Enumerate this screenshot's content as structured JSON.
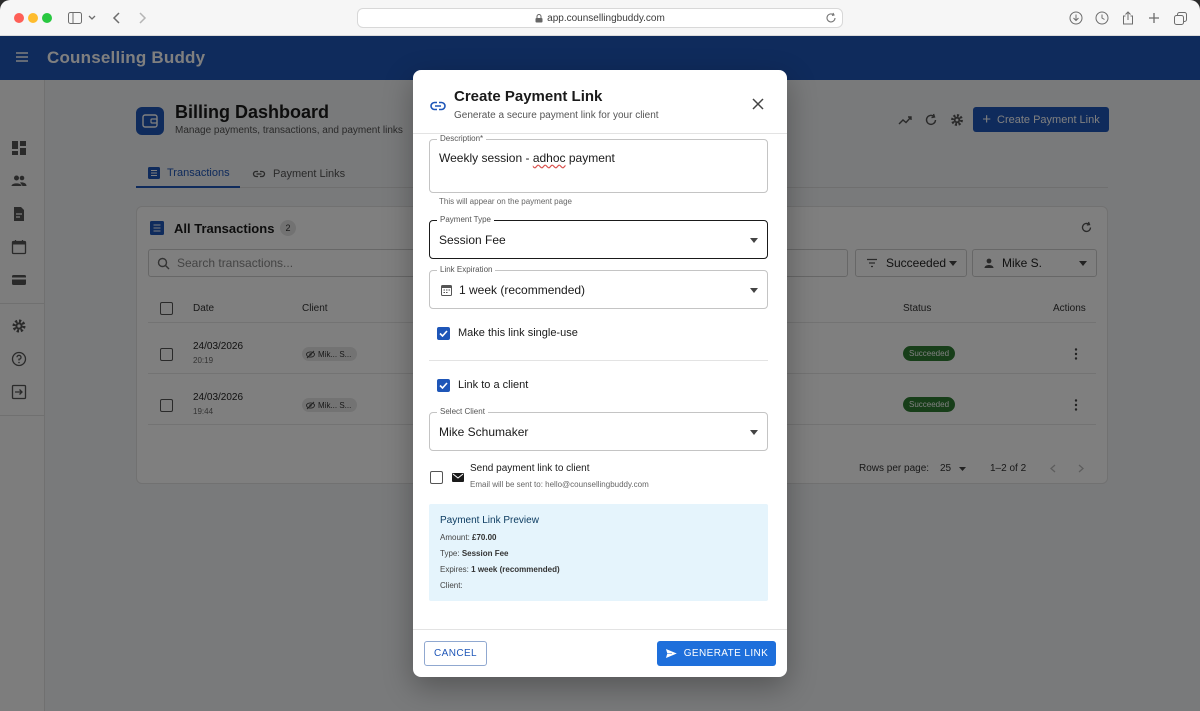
{
  "browser": {
    "url": "app.counsellingbuddy.com"
  },
  "app": {
    "brand": "Counselling Buddy"
  },
  "page": {
    "title": "Billing Dashboard",
    "subtitle": "Manage payments, transactions, and payment links",
    "create_button": "Create Payment Link",
    "tabs": [
      {
        "label": "Transactions"
      },
      {
        "label": "Payment Links"
      }
    ]
  },
  "transactions": {
    "title": "All Transactions",
    "count": "2",
    "search_placeholder": "Search transactions...",
    "status_filter": "Succeeded",
    "client_filter": "Mike S.",
    "columns": {
      "date": "Date",
      "client": "Client",
      "status": "Status",
      "actions": "Actions"
    },
    "rows": [
      {
        "date": "24/03/2026",
        "time": "20:19",
        "client": "Mik... S...",
        "status": "Succeeded"
      },
      {
        "date": "24/03/2026",
        "time": "19:44",
        "client": "Mik... S...",
        "status": "Succeeded"
      }
    ],
    "rows_per_page_label": "Rows per page:",
    "rows_per_page": "25",
    "range": "1–2 of 2"
  },
  "dialog": {
    "title": "Create Payment Link",
    "subtitle": "Generate a secure payment link for your client",
    "description": {
      "label": "Description",
      "required_mark": "*",
      "value_prefix": "Weekly session - ",
      "value_misspelled": "adhoc",
      "value_suffix": " payment",
      "helper": "This will appear on the payment page"
    },
    "payment_type": {
      "label": "Payment Type",
      "value": "Session Fee"
    },
    "link_expiration": {
      "label": "Link Expiration",
      "value": "1 week (recommended)"
    },
    "single_use": {
      "label": "Make this link single-use",
      "checked": true
    },
    "link_to_client": {
      "label": "Link to a client",
      "checked": true
    },
    "select_client": {
      "label": "Select Client",
      "value": "Mike Schumaker"
    },
    "send_email": {
      "label": "Send payment link to client",
      "helper": "Email will be sent to: hello@counsellingbuddy.com",
      "checked": false
    },
    "preview": {
      "title": "Payment Link Preview",
      "amount_label": "Amount:",
      "amount": "£70.00",
      "type_label": "Type:",
      "type": "Session Fee",
      "expires_label": "Expires:",
      "expires": "1 week (recommended)",
      "client_label": "Client:"
    },
    "cancel": "CANCEL",
    "generate": "GENERATE LINK"
  },
  "colors": {
    "primary": "#1e56b8",
    "button_primary": "#1e6fdb",
    "success": "#2e7d32",
    "preview_bg": "#e5f4fc"
  }
}
